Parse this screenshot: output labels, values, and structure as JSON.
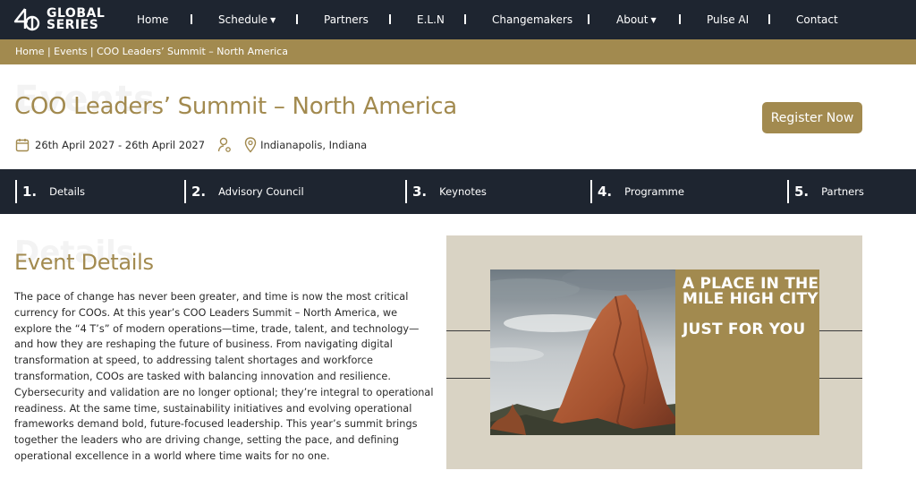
{
  "brand": {
    "line1": "GLOBAL",
    "line2": "SERIES"
  },
  "nav": {
    "items": [
      {
        "label": "Home",
        "caret": false
      },
      {
        "label": "Schedule",
        "caret": true
      },
      {
        "label": "Partners",
        "caret": false
      },
      {
        "label": "E.L.N",
        "caret": false
      },
      {
        "label": "Changemakers",
        "caret": false
      },
      {
        "label": "About",
        "caret": true
      },
      {
        "label": "Pulse AI",
        "caret": false
      },
      {
        "label": "Contact",
        "caret": false
      }
    ]
  },
  "breadcrumb": "Home | Events | COO Leaders’ Summit – North America",
  "hero": {
    "ghost_text": "Events",
    "title": "COO Leaders’ Summit – North America",
    "dates": "26th April 2027 - 26th April 2027",
    "location": "Indianapolis, Indiana",
    "register_label": "Register Now"
  },
  "tabs": [
    {
      "num": "1.",
      "label": "Details"
    },
    {
      "num": "2.",
      "label": "Advisory Council"
    },
    {
      "num": "3.",
      "label": "Keynotes"
    },
    {
      "num": "4.",
      "label": "Programme"
    },
    {
      "num": "5.",
      "label": "Partners"
    }
  ],
  "details": {
    "ghost_text": "Details",
    "title": "Event Details",
    "body": "The pace of change has never been greater, and time is now the most critical currency for COOs. At this year’s COO Leaders Summit – North America, we explore the “4 T’s” of modern operations—time, trade, talent, and technology—and how they are reshaping the future of business. From navigating digital transformation at speed, to addressing talent shortages and workforce transformation, COOs are tasked with balancing innovation and resilience. Cybersecurity and validation are no longer optional; they’re integral to operational readiness. At the same time, sustainability initiatives and evolving operational frameworks demand bold, future-focused leadership. This year’s summit brings together the leaders who are driving change, setting the pace, and defining operational excellence in a world where time waits for no one."
  },
  "promo": {
    "heading": "A PLACE IN THE MILE HIGH CITY",
    "subheading": "JUST FOR YOU"
  },
  "colors": {
    "navy": "#1e2530",
    "gold": "#a28a4f",
    "beige": "#d9d3c4"
  }
}
